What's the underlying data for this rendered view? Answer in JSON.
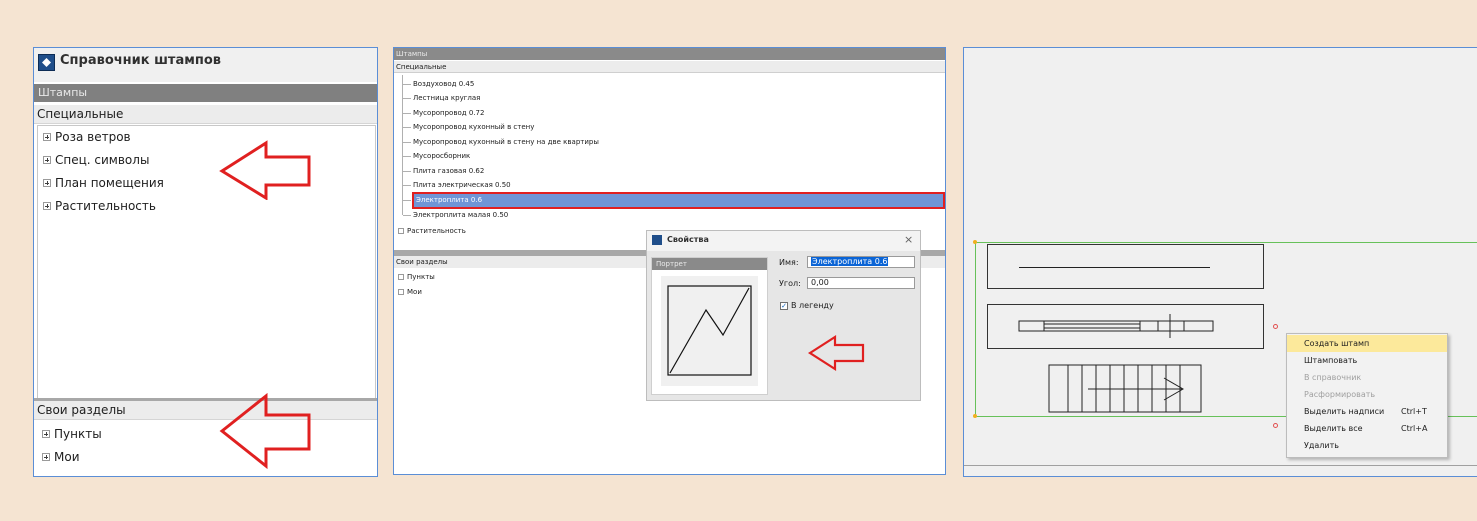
{
  "panel1": {
    "window_title": "Справочник штампов",
    "section_stamps": "Штампы",
    "section_special": "Специальные",
    "tree_special": [
      "Роза ветров",
      "Спец. символы",
      "План помещения",
      "Растительность"
    ],
    "section_own": "Свои разделы",
    "tree_own": [
      "Пункты",
      "Мои"
    ]
  },
  "panel2": {
    "header_stamps": "Штампы",
    "header_special": "Специальные",
    "leaves": [
      "Воздуховод 0.45",
      "Лестница круглая",
      "Мусоропровод 0.72",
      "Мусоропровод кухонный в стену",
      "Мусоропровод кухонный в стену на две квартиры",
      "Мусоросборник",
      "Плита газовая 0.62",
      "Плита электрическая 0.50",
      "Электроплита 0.6",
      "Электроплита малая 0.50"
    ],
    "selected_index": 8,
    "group_plants": "Растительность",
    "header_own": "Свои разделы",
    "tree_own": [
      "Пункты",
      "Мои"
    ],
    "dialog": {
      "title": "Свойства",
      "close_glyph": "×",
      "portrait_tab": "Портрет",
      "name_label": "Имя:",
      "name_value": "Электроплита 0.6",
      "angle_label": "Угол:",
      "angle_value": "0,00",
      "legend_label": "В легенду",
      "legend_checked": true,
      "check_glyph": "✓"
    }
  },
  "panel3": {
    "context_menu": [
      {
        "label": "Создать штамп",
        "shortcut": "",
        "state": "highlighted"
      },
      {
        "label": "Штамповать",
        "shortcut": "",
        "state": "enabled"
      },
      {
        "label": "В справочник",
        "shortcut": "",
        "state": "disabled"
      },
      {
        "label": "Расформировать",
        "shortcut": "",
        "state": "disabled"
      },
      {
        "label": "Выделить надписи",
        "shortcut": "Ctrl+T",
        "state": "enabled"
      },
      {
        "label": "Выделить все",
        "shortcut": "Ctrl+A",
        "state": "enabled"
      },
      {
        "label": "Удалить",
        "shortcut": "",
        "state": "enabled"
      }
    ]
  },
  "colors": {
    "page_bg": "#f5e4d2",
    "panel_border": "#5b8ed6",
    "arrow_red": "#e02020",
    "selection_blue": "#6f95d6",
    "menu_highlight": "#fce99b",
    "selection_green": "#67c15a"
  },
  "icons": [
    "app-logo-icon",
    "expand-plus-icon",
    "close-icon",
    "checkbox-checked-icon",
    "red-arrow-left-icon"
  ]
}
